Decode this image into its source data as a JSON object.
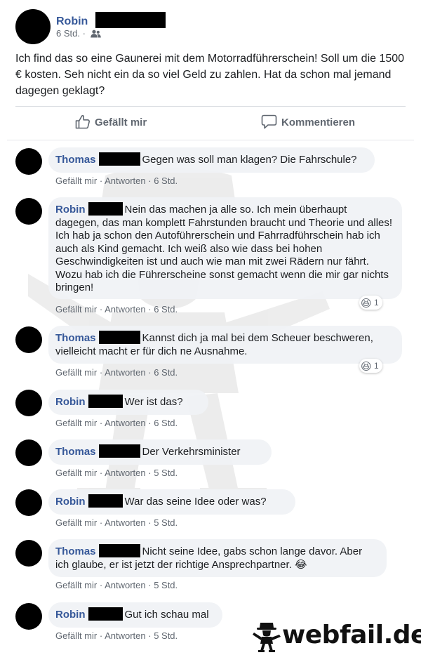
{
  "post": {
    "author": "Robin",
    "time": "6 Std.",
    "audience_icon": "friends-icon",
    "text": "Ich find das so eine Gaunerei mit dem Motorradführerschein! Soll um die 1500 € kosten. Seh nicht ein da so viel Geld zu zahlen. Hat da schon mal jemand dagegen geklagt?",
    "like_label": "Gefällt mir",
    "comment_label": "Kommentieren"
  },
  "comment_action": {
    "like": "Gefällt mir",
    "reply": "Antworten"
  },
  "comments": [
    {
      "author": "Thomas",
      "text": "Gegen was soll man klagen? Die Fahrschule?",
      "time": "6 Std."
    },
    {
      "author": "Robin",
      "text": "Nein das machen ja alle so. Ich mein überhaupt dagegen, das man komplett Fahrstunden braucht und Theorie und alles! Ich hab ja schon den Autoführerschein und Fahrradführschein hab ich auch als Kind gemacht. Ich weiß also wie dass bei hohen Geschwindigkeiten ist und auch wie man mit zwei Rädern nur fährt. Wozu hab ich die Führerscheine sonst gemacht wenn die mir gar nichts bringen!",
      "time": "6 Std.",
      "reaction": "1"
    },
    {
      "author": "Thomas",
      "text": "Kannst dich ja mal bei dem Scheuer beschweren, vielleicht macht er für dich ne Ausnahme.",
      "time": "6 Std.",
      "reaction": "1"
    },
    {
      "author": "Robin",
      "text": "Wer ist das?",
      "time": "6 Std."
    },
    {
      "author": "Thomas",
      "text": "Der Verkehrsminister",
      "time": "5 Std."
    },
    {
      "author": "Robin",
      "text": "War das seine Idee oder was?",
      "time": "5 Std."
    },
    {
      "author": "Thomas",
      "text": "Nicht seine Idee, gabs schon lange davor. Aber ich glaube, er ist jetzt der richtige Ansprechpartner. 😂",
      "time": "5 Std."
    },
    {
      "author": "Robin",
      "text": "Gut ich schau mal",
      "time": "5 Std."
    }
  ],
  "reaction_emoji": "😆",
  "watermark": "webfail.de",
  "colors": {
    "name": "#365899",
    "bubble": "#f0f2f5",
    "meta": "#606770"
  }
}
